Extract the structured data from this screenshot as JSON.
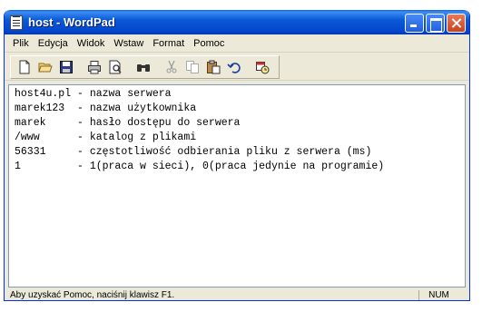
{
  "window": {
    "title": "host - WordPad"
  },
  "menu": {
    "items": [
      "Plik",
      "Edycja",
      "Widok",
      "Wstaw",
      "Format",
      "Pomoc"
    ]
  },
  "toolbar": {
    "icons": [
      "new-document-icon",
      "open-folder-icon",
      "save-icon",
      "print-icon",
      "print-preview-icon",
      "find-icon",
      "cut-icon",
      "copy-icon",
      "paste-icon",
      "undo-icon",
      "date-time-icon"
    ]
  },
  "document": {
    "lines": [
      "host4u.pl - nazwa serwera",
      "marek123  - nazwa użytkownika",
      "marek     - hasło dostępu do serwera",
      "/www      - katalog z plikami",
      "56331     - częstotliwość odbierania pliku z serwera (ms)",
      "1         - 1(praca w sieci), 0(praca jedynie na programie)"
    ]
  },
  "status": {
    "help_text": "Aby uzyskać Pomoc, naciśnij klawisz F1.",
    "num": "NUM"
  }
}
